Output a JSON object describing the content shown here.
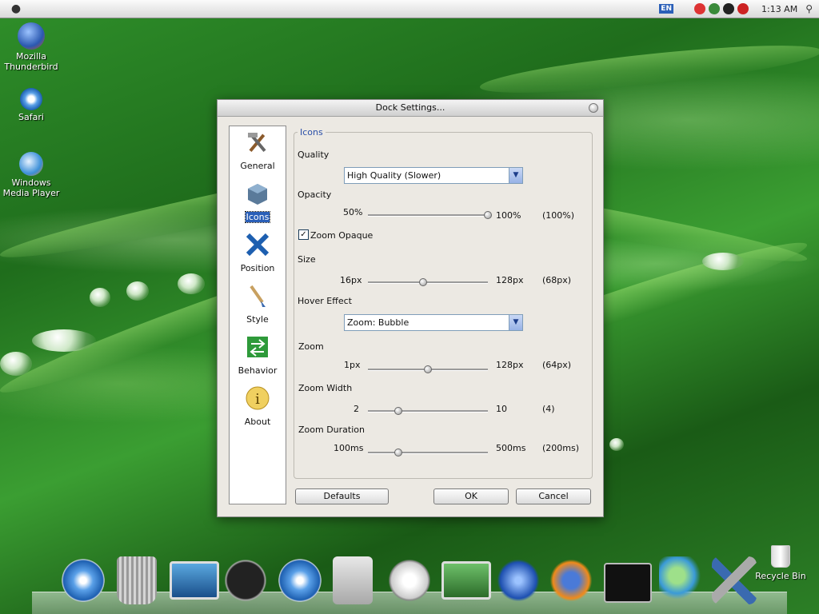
{
  "menubar": {
    "apple_icon": "apple-icon",
    "language": "EN",
    "clock": "1:13 AM",
    "clock_icon": "search-icon"
  },
  "desktop_icons": [
    {
      "label": "Mozilla Thunderbird",
      "icon": "thunderbird-icon"
    },
    {
      "label": "Safari",
      "icon": "safari-icon"
    },
    {
      "label": "Windows Media Player",
      "icon": "media-player-icon"
    }
  ],
  "dialog": {
    "title": "Dock Settings...",
    "sidebar": [
      {
        "label": "General",
        "icon": "tools-icon"
      },
      {
        "label": "Icons",
        "icon": "box-icon",
        "selected": true
      },
      {
        "label": "Position",
        "icon": "arrows-icon"
      },
      {
        "label": "Style",
        "icon": "brush-icon"
      },
      {
        "label": "Behavior",
        "icon": "behavior-icon"
      },
      {
        "label": "About",
        "icon": "info-icon"
      }
    ],
    "group_title": "Icons",
    "quality": {
      "label": "Quality",
      "value": "High Quality (Slower)"
    },
    "opacity": {
      "label": "Opacity",
      "min": "50%",
      "max": "100%",
      "current": "(100%)",
      "level": 1.0
    },
    "zoom_opaque": {
      "label": "Zoom Opaque",
      "checked": true
    },
    "size": {
      "label": "Size",
      "min": "16px",
      "max": "128px",
      "current": "(68px)",
      "level": 0.46
    },
    "hover_effect": {
      "label": "Hover Effect",
      "value": "Zoom: Bubble"
    },
    "zoom": {
      "label": "Zoom",
      "min": "1px",
      "max": "128px",
      "current": "(64px)",
      "level": 0.5
    },
    "zoom_width": {
      "label": "Zoom Width",
      "min": "2",
      "max": "10",
      "current": "(4)",
      "level": 0.25
    },
    "zoom_duration": {
      "label": "Zoom Duration",
      "min": "100ms",
      "max": "500ms",
      "current": "(200ms)",
      "level": 0.25
    },
    "buttons": {
      "defaults": "Defaults",
      "ok": "OK",
      "cancel": "Cancel"
    }
  },
  "dock": {
    "items": [
      "safari-icon",
      "trash-icon",
      "imac-icon",
      "dashboard-icon",
      "safari-icon",
      "hard-drive-icon",
      "itunes-icon",
      "imac-icon",
      "thunderbird-icon",
      "firefox-icon",
      "terminal-icon",
      "messenger-icon",
      "tools-icon"
    ],
    "recycle_bin": "Recycle Bin"
  },
  "colors": {
    "accent": "#2a5fb8",
    "selection": "#2a5fb8"
  }
}
